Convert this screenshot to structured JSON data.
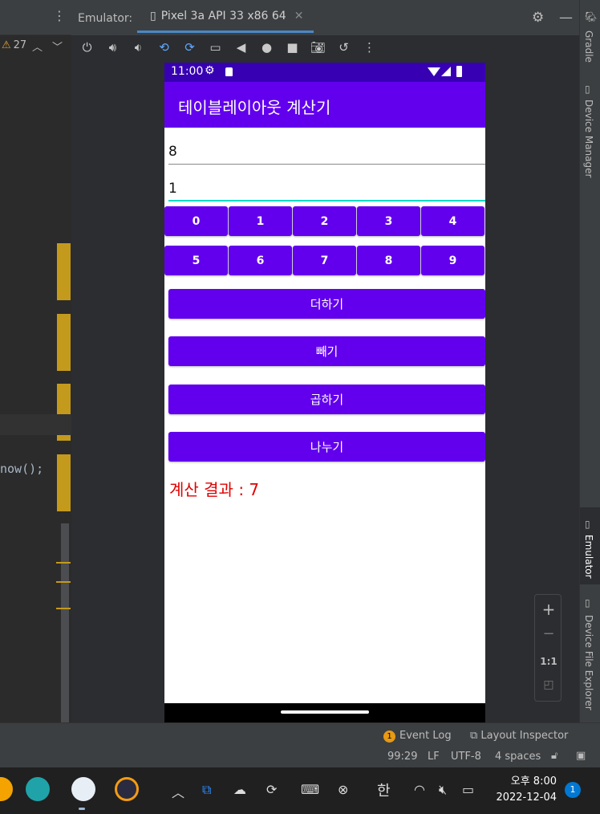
{
  "ide": {
    "warning_count": "27",
    "code_snippet": "now();",
    "emulator_label": "Emulator:",
    "device_tab": "Pixel 3a API 33 x86 64",
    "right_tools": [
      "Gradle",
      "Device Manager",
      "Emulator",
      "Device File Explorer"
    ],
    "bottom": {
      "event_log": "Event Log",
      "event_count": "1",
      "layout_inspector": "Layout Inspector",
      "position": "99:29",
      "line_sep": "LF",
      "encoding": "UTF-8",
      "indent": "4 spaces"
    },
    "zoom": {
      "plus": "+",
      "minus": "−",
      "ratio": "1:1"
    }
  },
  "phone": {
    "status_time": "11:00",
    "app_title": "테이블레이아웃 계산기",
    "input1_value": "8",
    "input2_value": "1",
    "digits_row1": [
      "0",
      "1",
      "2",
      "3",
      "4"
    ],
    "digits_row2": [
      "5",
      "6",
      "7",
      "8",
      "9"
    ],
    "ops": {
      "add": "더하기",
      "sub": "빼기",
      "mul": "곱하기",
      "div": "나누기"
    },
    "result": "계산 결과 : 7"
  },
  "taskbar": {
    "ime": "한",
    "time": "오후 8:00",
    "date": "2022-12-04",
    "notification_count": "1"
  },
  "colors": {
    "primary": "#6200ee",
    "status_bar": "#3700b3",
    "accent": "#03dac5",
    "result_text": "#e00000"
  }
}
